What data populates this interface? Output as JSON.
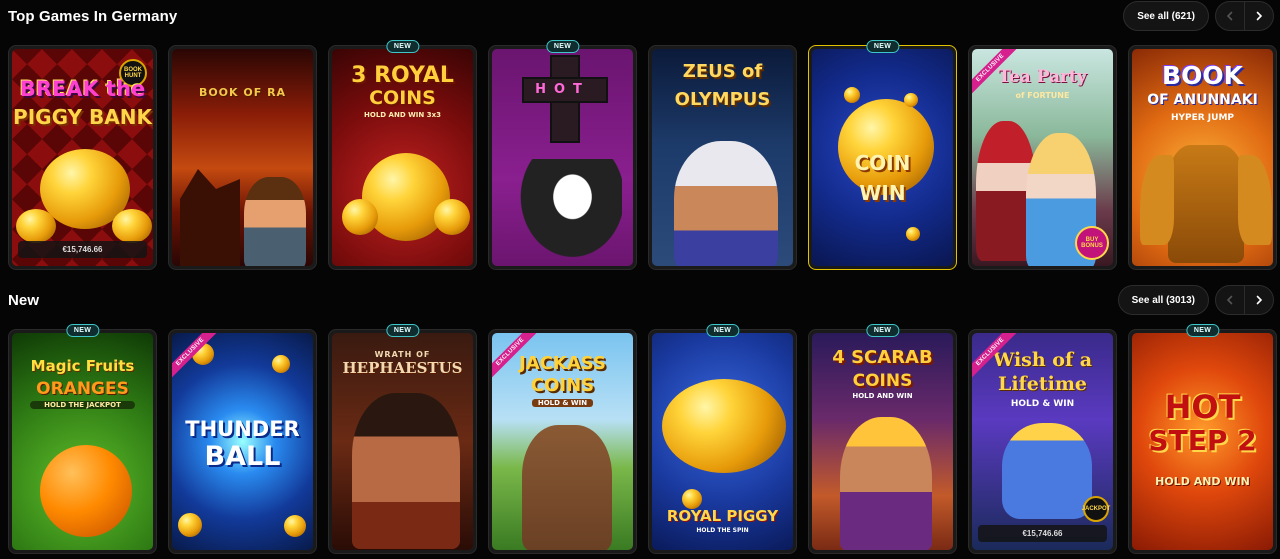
{
  "sections": [
    {
      "title": "Top Games In Germany",
      "see_all_label": "See all (621)",
      "games": [
        {
          "title_line1": "BREAK the",
          "title_line2": "PIGGY BANK",
          "badge": "",
          "jackpot": "€15,746.66",
          "corner_label": "BOOK HUNT"
        },
        {
          "title_line1": "BOOK OF RA",
          "badge": "",
          "jackpot": ""
        },
        {
          "title_line1": "3 ROYAL",
          "title_line2": "COINS",
          "subtitle": "HOLD AND WIN 3x3",
          "badge": "NEW",
          "jackpot": ""
        },
        {
          "title_line1": "HOT",
          "title_line2": "CROSS",
          "badge": "NEW",
          "jackpot": ""
        },
        {
          "title_line1": "ZEUS of",
          "title_line2": "OLYMPUS",
          "badge": "",
          "jackpot": ""
        },
        {
          "title_line1": "COIN",
          "title_line2": "WIN",
          "badge": "NEW",
          "jackpot": ""
        },
        {
          "title_line1": "Tea Party",
          "title_line2": "of FORTUNE",
          "badge": "EXCLUSIVE",
          "jackpot": "",
          "corner_label": "BUY BONUS"
        },
        {
          "title_line1": "BOOK",
          "title_line2": "OF ANUNNAKI",
          "subtitle": "HYPER JUMP",
          "badge": "",
          "jackpot": ""
        }
      ]
    },
    {
      "title": "New",
      "see_all_label": "See all (3013)",
      "games": [
        {
          "title_line1": "Magic Fruits",
          "title_line2": "ORANGES",
          "subtitle": "HOLD THE JACKPOT",
          "badge": "NEW",
          "jackpot": ""
        },
        {
          "title_line1": "THUNDER",
          "title_line2": "BALL",
          "badge": "EXCLUSIVE",
          "jackpot": ""
        },
        {
          "title_line1": "WRATH OF",
          "title_line2": "HEPHAESTUS",
          "badge": "NEW",
          "jackpot": ""
        },
        {
          "title_line1": "JACKASS",
          "title_line2": "COINS",
          "subtitle": "HOLD & WIN",
          "badge": "EXCLUSIVE",
          "jackpot": ""
        },
        {
          "title_line1": "ROYAL PIGGY",
          "subtitle": "HOLD THE SPIN",
          "badge": "NEW",
          "jackpot": ""
        },
        {
          "title_line1": "4 SCARAB",
          "title_line2": "COINS",
          "subtitle": "HOLD AND WIN",
          "badge": "NEW",
          "jackpot": ""
        },
        {
          "title_line1": "Wish of a",
          "title_line2": "Lifetime",
          "subtitle": "HOLD & WIN",
          "badge": "EXCLUSIVE",
          "jackpot": "€15,746.66",
          "corner_label": "JACKPOT"
        },
        {
          "title_line1": "HOT",
          "title_line2": "STEP 2",
          "subtitle": "HOLD AND WIN",
          "badge": "NEW",
          "jackpot": ""
        }
      ]
    }
  ],
  "icons": {
    "prev": "chevron-left-icon",
    "next": "chevron-right-icon"
  },
  "colors": {
    "background": "#050505",
    "new_badge_border": "#3ec6c9",
    "exclusive_ribbon": "#d5208d"
  }
}
